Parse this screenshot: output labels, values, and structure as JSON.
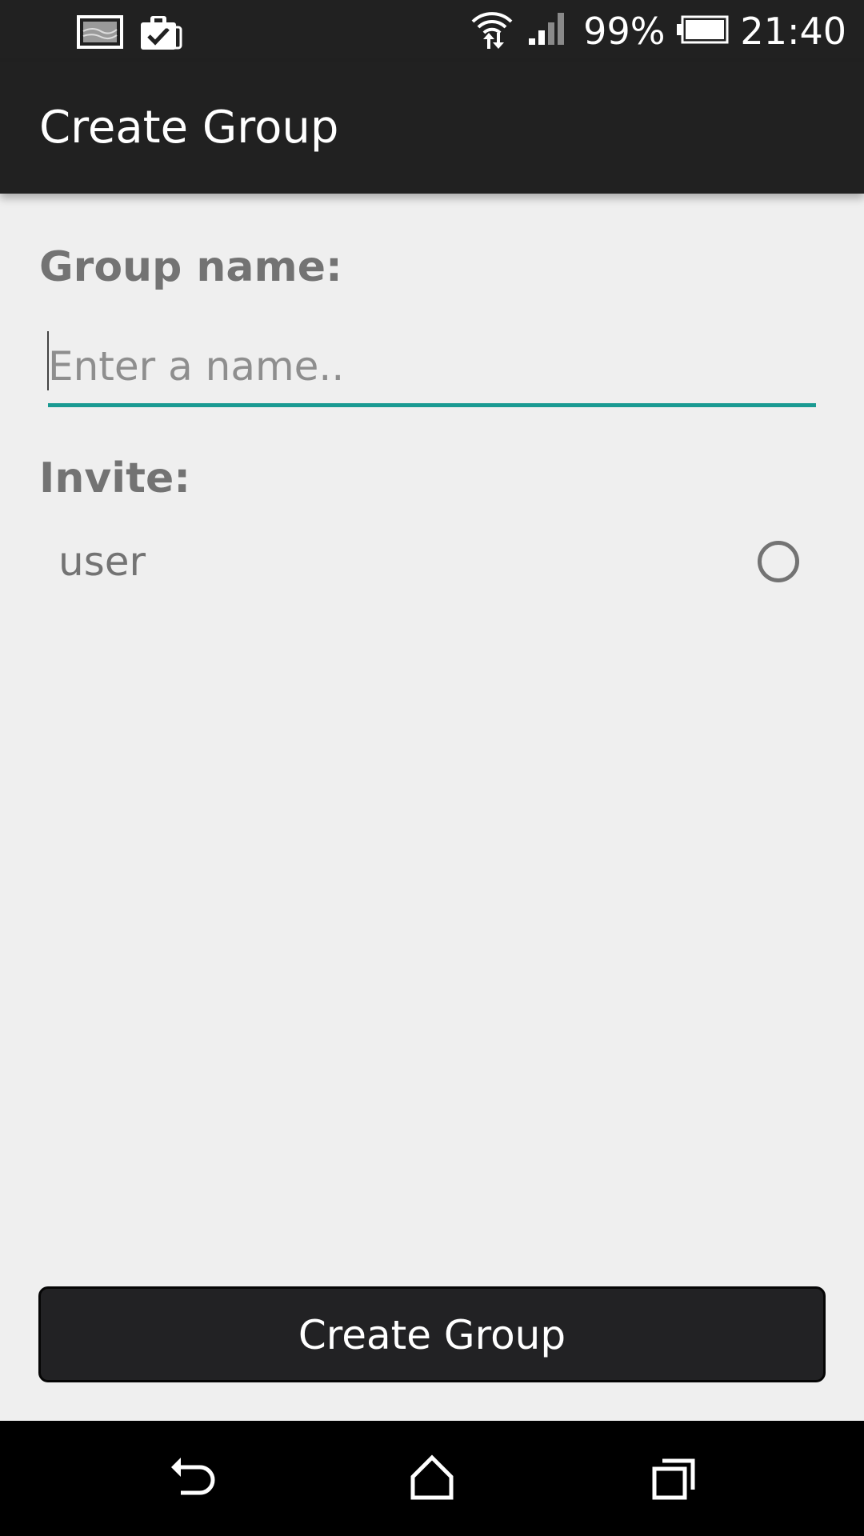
{
  "status_bar": {
    "battery_percent": "99%",
    "time": "21:40",
    "icons": [
      "gallery-icon",
      "clipboard-check-icon",
      "wifi-icon",
      "signal-icon",
      "battery-icon"
    ]
  },
  "app_bar": {
    "title": "Create Group"
  },
  "form": {
    "group_name_label": "Group name:",
    "group_name_placeholder": "Enter a name..",
    "group_name_value": "",
    "invite_label": "Invite:",
    "users": [
      {
        "name": "user",
        "selected": false
      }
    ],
    "create_button_label": "Create Group"
  },
  "nav_bar": {
    "icons": [
      "back-icon",
      "home-icon",
      "recent-apps-icon"
    ]
  },
  "colors": {
    "accent": "#1a9a92",
    "bar_background": "#212121",
    "content_background": "#efefef",
    "label_text": "#737373"
  }
}
